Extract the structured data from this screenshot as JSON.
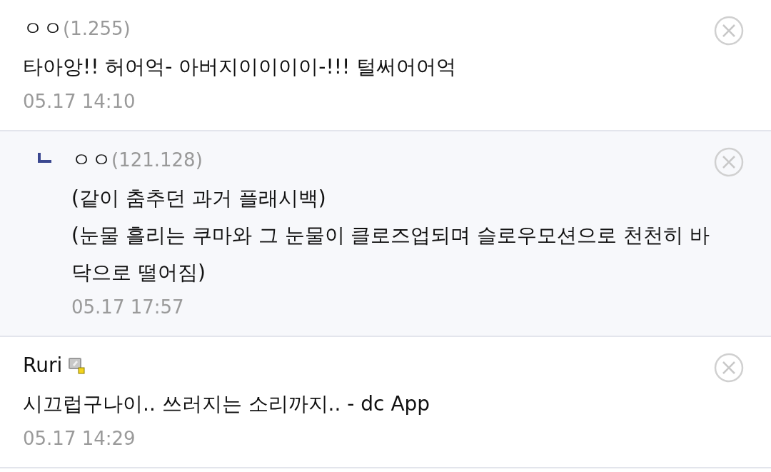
{
  "comments": [
    {
      "reply": false,
      "nickname": "ㅇㅇ",
      "ip": "(1.255)",
      "member_badge": false,
      "lines": [
        "타아앙!! 허어억- 아버지이이이이-!!! 털써어어억"
      ],
      "time": "05.17 14:10"
    },
    {
      "reply": true,
      "nickname": "ㅇㅇ",
      "ip": "(121.128)",
      "member_badge": false,
      "lines": [
        "(같이 춤추던 과거 플래시백)",
        "(눈물 흘리는 쿠마와 그 눈물이 클로즈업되며 슬로우모션으로 천천히 바닥으로 떨어짐)"
      ],
      "time": "05.17 17:57"
    },
    {
      "reply": false,
      "nickname": "Ruri",
      "member_badge": true,
      "lines": [
        "시끄럽구나이.. 쓰러지는 소리까지.. - dc App"
      ],
      "time": "05.17 14:29"
    }
  ]
}
